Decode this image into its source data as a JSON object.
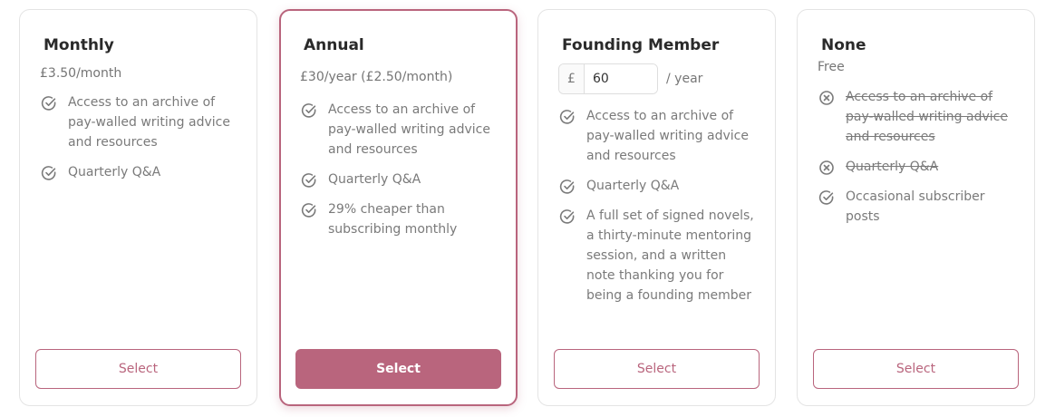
{
  "accent_color": "#b9657d",
  "plans": [
    {
      "name": "Monthly",
      "price": "£3.50/month",
      "features": [
        {
          "text": "Access to an archive of pay-walled writing advice and resources",
          "included": true,
          "icon": "check-circle-icon"
        },
        {
          "text": "Quarterly Q&A",
          "included": true,
          "icon": "check-circle-icon"
        }
      ],
      "button": "Select"
    },
    {
      "name": "Annual",
      "price": "£30/year (£2.50/month)",
      "highlighted": true,
      "features": [
        {
          "text": "Access to an archive of pay-walled writing advice and resources",
          "included": true,
          "icon": "check-circle-icon"
        },
        {
          "text": "Quarterly Q&A",
          "included": true,
          "icon": "check-circle-icon"
        },
        {
          "text": "29% cheaper than subscribing monthly",
          "included": true,
          "icon": "check-circle-icon"
        }
      ],
      "button": "Select"
    },
    {
      "name": "Founding Member",
      "currency_symbol": "£",
      "amount": "60",
      "period": "/ year",
      "features": [
        {
          "text": "Access to an archive of pay-walled writing advice and resources",
          "included": true,
          "icon": "check-circle-icon"
        },
        {
          "text": "Quarterly Q&A",
          "included": true,
          "icon": "check-circle-icon"
        },
        {
          "text": "A full set of signed novels, a thirty-minute mentoring session, and a written note thanking you for being a founding member",
          "included": true,
          "icon": "check-circle-icon"
        }
      ],
      "button": "Select"
    },
    {
      "name": "None",
      "price": "Free",
      "features": [
        {
          "text": "Access to an archive of pay-walled writing advice and resources",
          "included": false,
          "icon": "x-circle-icon"
        },
        {
          "text": "Quarterly Q&A",
          "included": false,
          "icon": "x-circle-icon"
        },
        {
          "text": "Occasional subscriber posts",
          "included": true,
          "icon": "check-circle-icon"
        }
      ],
      "button": "Select"
    }
  ]
}
